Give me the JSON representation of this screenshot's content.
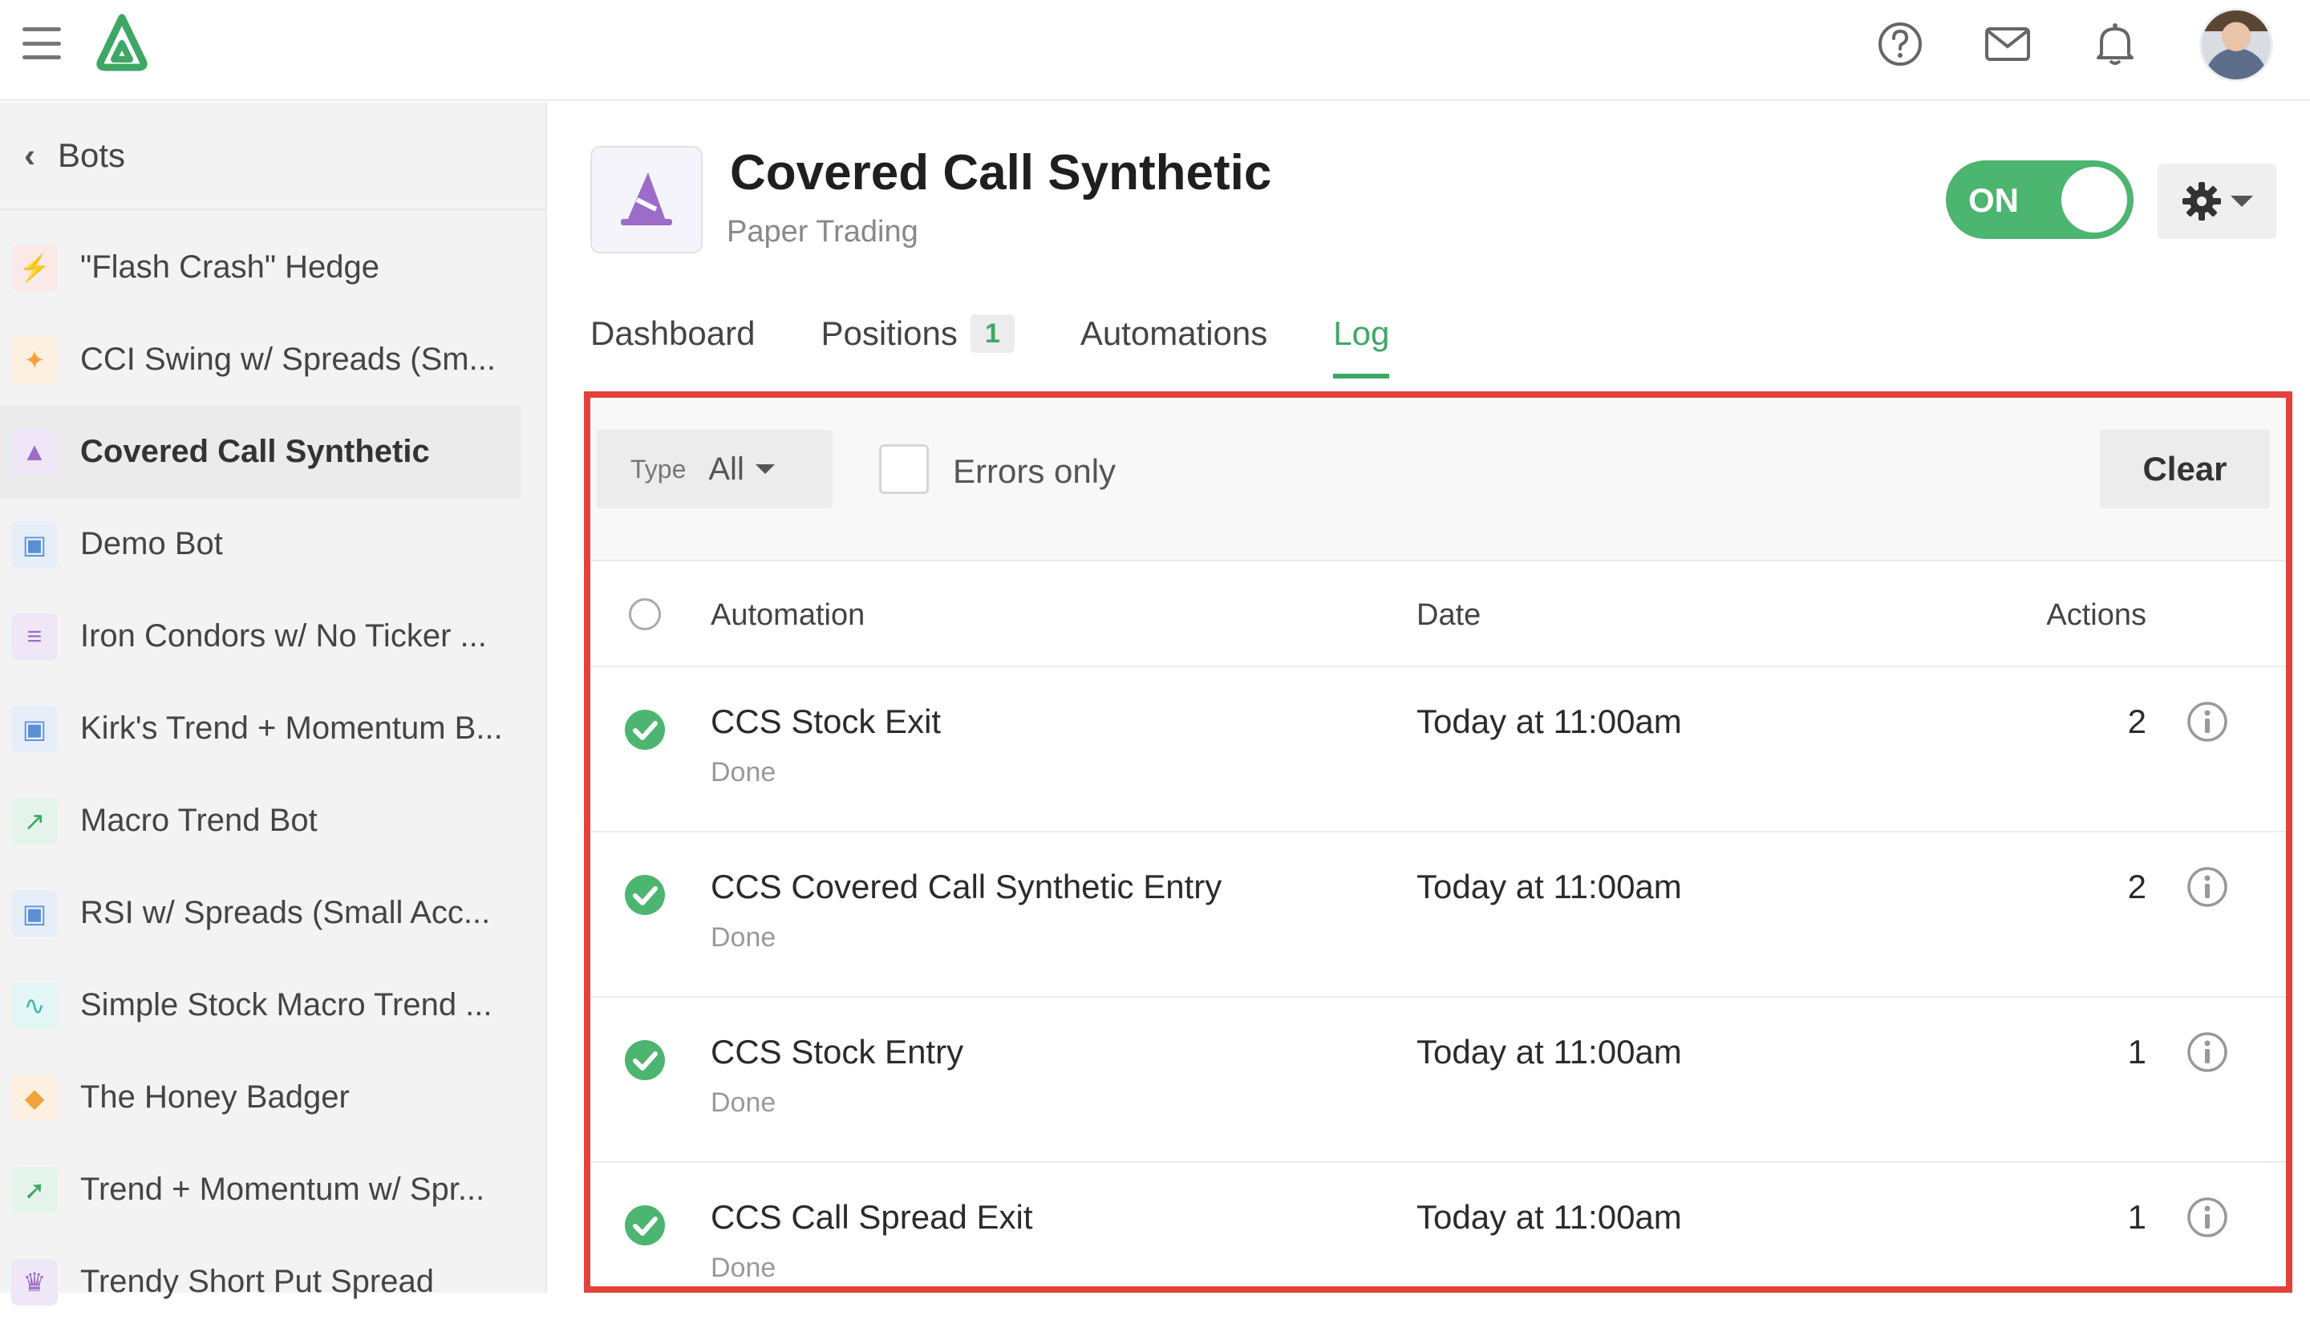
{
  "topbar": {
    "help_icon": "question-circle-icon",
    "mail_icon": "envelope-icon",
    "notifications_icon": "bell-icon"
  },
  "sidebar": {
    "back_label": "Bots",
    "items": [
      {
        "label": "\"Flash Crash\" Hedge",
        "icon": "lightning-icon",
        "color": "#e2574c"
      },
      {
        "label": "CCI Swing w/ Spreads (Sm...",
        "icon": "blaster-icon",
        "color": "#f2a23a"
      },
      {
        "label": "Covered Call Synthetic",
        "icon": "wizard-icon",
        "color": "#9b6cc9"
      },
      {
        "label": "Demo Bot",
        "icon": "robot-icon",
        "color": "#5a8fd6"
      },
      {
        "label": "Iron Condors w/ No Ticker ...",
        "icon": "iron-condor-icon",
        "color": "#9b6cc9"
      },
      {
        "label": "Kirk's Trend + Momentum B...",
        "icon": "robot-icon",
        "color": "#5a8fd6"
      },
      {
        "label": "Macro Trend Bot",
        "icon": "line-chart-icon",
        "color": "#3ea765"
      },
      {
        "label": "RSI w/ Spreads (Small Acc...",
        "icon": "robot-icon",
        "color": "#5a8fd6"
      },
      {
        "label": "Simple Stock Macro Trend ...",
        "icon": "pulse-icon",
        "color": "#3fb7b0"
      },
      {
        "label": "The Honey Badger",
        "icon": "badger-icon",
        "color": "#f2a23a"
      },
      {
        "label": "Trend + Momentum w/ Spr...",
        "icon": "rocket-icon",
        "color": "#3ea765"
      },
      {
        "label": "Trendy Short Put Spread",
        "icon": "crown-icon",
        "color": "#9b6cc9"
      }
    ]
  },
  "bot": {
    "title": "Covered Call Synthetic",
    "subtitle": "Paper Trading",
    "toggle_label": "ON"
  },
  "tabs": [
    {
      "label": "Dashboard"
    },
    {
      "label": "Positions",
      "count": "1"
    },
    {
      "label": "Automations"
    },
    {
      "label": "Log"
    }
  ],
  "filters": {
    "type_key": "Type",
    "type_value": "All",
    "errors_only_label": "Errors only",
    "clear_label": "Clear"
  },
  "table": {
    "headers": {
      "automation": "Automation",
      "date": "Date",
      "actions": "Actions"
    },
    "rows": [
      {
        "name": "CCS Stock Exit",
        "status": "Done",
        "date": "Today at 11:00am",
        "actions": "2"
      },
      {
        "name": "CCS Covered Call Synthetic Entry",
        "status": "Done",
        "date": "Today at 11:00am",
        "actions": "2"
      },
      {
        "name": "CCS Stock Entry",
        "status": "Done",
        "date": "Today at 11:00am",
        "actions": "1"
      },
      {
        "name": "CCS Call Spread Exit",
        "status": "Done",
        "date": "Today at 11:00am",
        "actions": "1"
      }
    ]
  },
  "colors": {
    "accent_green": "#3ea765",
    "toggle_green": "#4cb56f",
    "highlight_red": "#e2423a"
  }
}
